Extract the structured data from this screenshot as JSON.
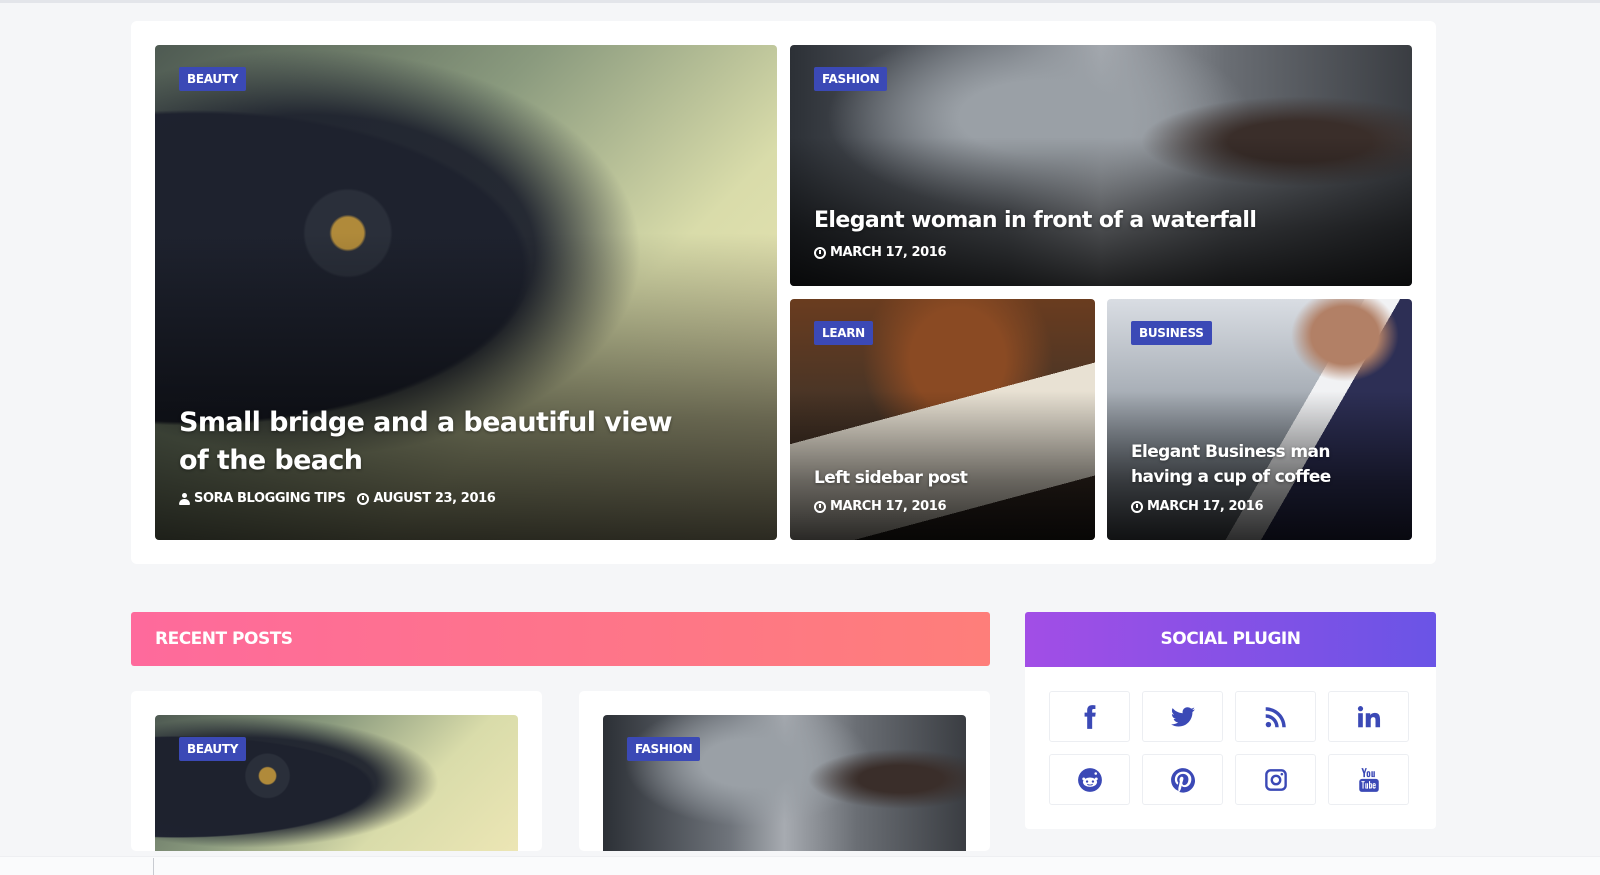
{
  "featured": {
    "main": {
      "category": "BEAUTY",
      "title": "Small bridge and a beautiful view of the beach",
      "author": "SORA BLOGGING TIPS",
      "date": "AUGUST 23, 2016"
    },
    "top_right": {
      "category": "FASHION",
      "title": "Elegant woman in front of a waterfall",
      "date": "MARCH 17, 2016"
    },
    "bottom_left": {
      "category": "LEARN",
      "title": "Left sidebar post",
      "date": "MARCH 17, 2016"
    },
    "bottom_right": {
      "category": "BUSINESS",
      "title": "Elegant Business man having a cup of coffee",
      "date": "MARCH 17, 2016"
    }
  },
  "recent_posts": {
    "heading": "RECENT POSTS",
    "posts": [
      {
        "category": "BEAUTY"
      },
      {
        "category": "FASHION"
      }
    ]
  },
  "social": {
    "heading": "SOCIAL PLUGIN",
    "buttons": [
      "facebook-icon",
      "twitter-icon",
      "rss-icon",
      "linkedin-icon",
      "reddit-icon",
      "pinterest-icon",
      "instagram-icon",
      "youtube-icon"
    ]
  },
  "colors": {
    "accent_badge": "#3b49b6",
    "recent_gradient_start": "#fe6a9c",
    "recent_gradient_end": "#fe7e7a",
    "social_gradient_start": "#a24ee6",
    "social_gradient_end": "#6a54e6"
  }
}
